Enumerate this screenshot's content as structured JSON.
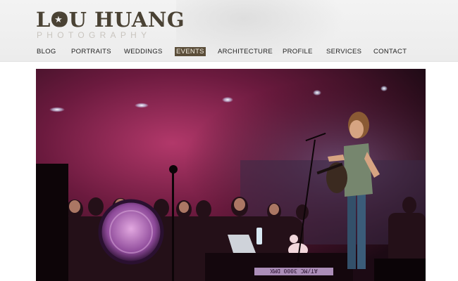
{
  "brand": {
    "name_part1": "LOU HU",
    "name_part2": "ANG",
    "name_display": "LOU HUANG",
    "tagline": "PHOTOGRAPHY",
    "color": "#4a4234"
  },
  "nav": {
    "items": [
      {
        "label": "BLOG"
      },
      {
        "label": "PORTRAITS"
      },
      {
        "label": "WEDDINGS"
      },
      {
        "label": "EVENTS",
        "active": true
      },
      {
        "label": "ARCHITECTURE"
      },
      {
        "label": "PROFILE"
      },
      {
        "label": "SERVICES"
      },
      {
        "label": "CONTACT"
      }
    ],
    "active_color": "#5b4e3a"
  },
  "photo": {
    "keyboard_text": "AT/MC 3000 DMX"
  }
}
